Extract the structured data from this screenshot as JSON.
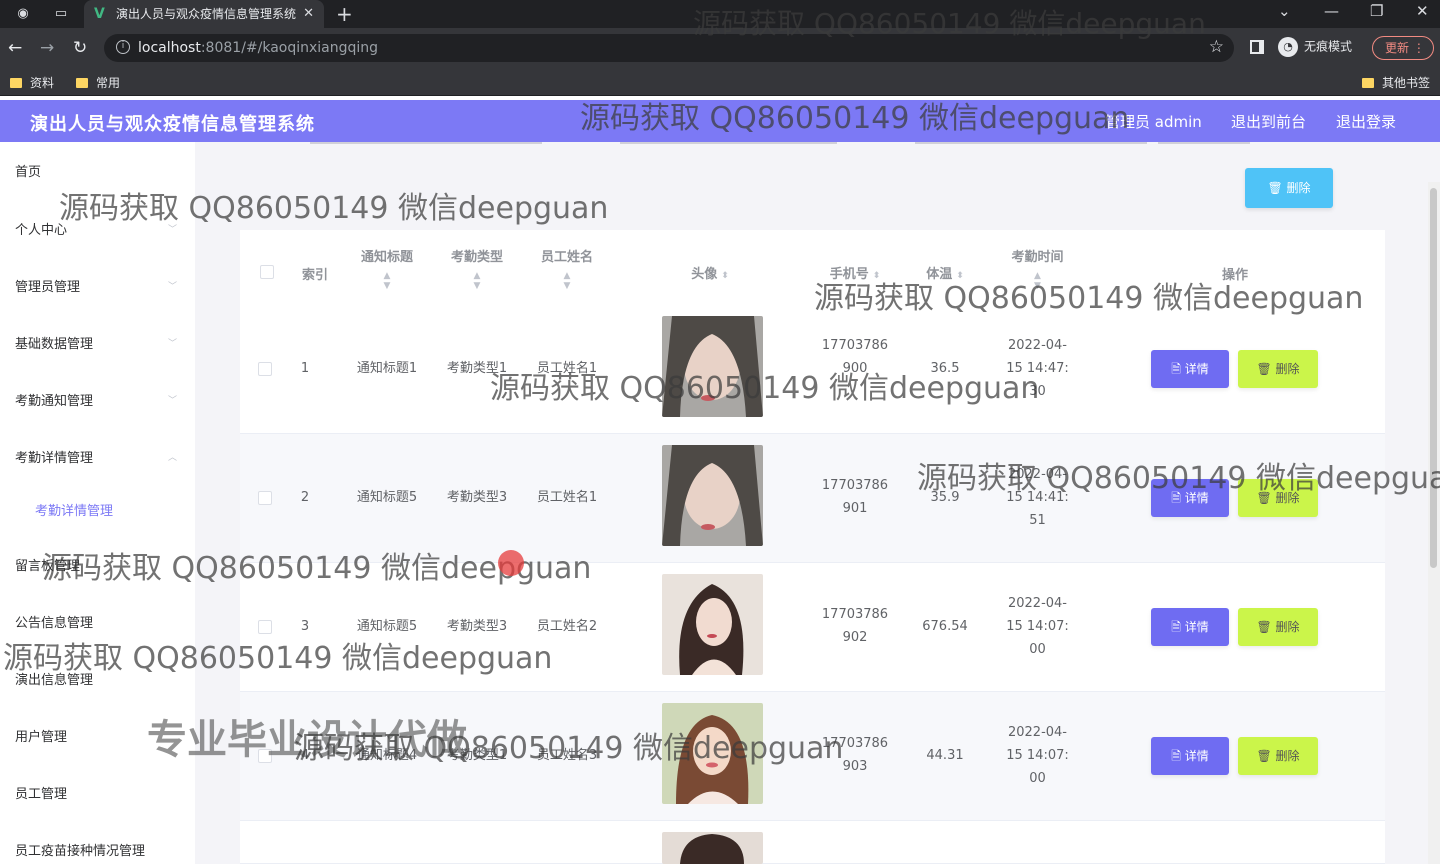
{
  "browser": {
    "tab_title": "演出人员与观众疫情信息管理系统",
    "url_host": "localhost",
    "url_rest": ":8081/#/kaoqinxiangqing",
    "incognito_label": "无痕模式",
    "update_label": "更新",
    "bookmarks": [
      "资料",
      "常用"
    ],
    "other_bookmarks": "其他书签"
  },
  "header": {
    "title": "演出人员与观众疫情信息管理系统",
    "admin_label": "管理员 admin",
    "back_label": "退出到前台",
    "logout_label": "退出登录"
  },
  "sidebar": {
    "items": [
      "首页",
      "个人中心",
      "管理员管理",
      "基础数据管理",
      "考勤通知管理",
      "考勤详情管理",
      "考勤详情管理",
      "留言板管理",
      "公告信息管理",
      "演出信息管理",
      "用户管理",
      "员工管理",
      "员工疫苗接种情况管理"
    ]
  },
  "toolbar": {
    "delete_label": "删除"
  },
  "table": {
    "headers": {
      "index": "索引",
      "title": "通知标题",
      "type": "考勤类型",
      "name": "员工姓名",
      "avatar": "头像",
      "phone": "手机号",
      "temp": "体温",
      "time": "考勤时间",
      "ops": "操作"
    },
    "detail_label": "详情",
    "delete_label": "删除",
    "rows": [
      {
        "index": "1",
        "title": "通知标题1",
        "type": "考勤类型1",
        "name": "员工姓名1",
        "phone1": "17703786",
        "phone2": "900",
        "temp": "36.5",
        "t1": "2022-04-",
        "t2": "15 14:47:",
        "t3": "30"
      },
      {
        "index": "2",
        "title": "通知标题5",
        "type": "考勤类型3",
        "name": "员工姓名1",
        "phone1": "17703786",
        "phone2": "901",
        "temp": "35.9",
        "t1": "2022-04-",
        "t2": "15 14:41:",
        "t3": "51"
      },
      {
        "index": "3",
        "title": "通知标题5",
        "type": "考勤类型3",
        "name": "员工姓名2",
        "phone1": "17703786",
        "phone2": "902",
        "temp": "676.54",
        "t1": "2022-04-",
        "t2": "15 14:07:",
        "t3": "00"
      },
      {
        "index": "4",
        "title": "通知标题4",
        "type": "考勤类型1",
        "name": "员工姓名3",
        "phone1": "17703786",
        "phone2": "903",
        "temp": "44.31",
        "t1": "2022-04-",
        "t2": "15 14:07:",
        "t3": "00"
      }
    ]
  },
  "watermarks": {
    "source": "源码获取 QQ86050149 微信deepguan",
    "source_cut": "源码获取 QQ86050149 微信deepguar",
    "pro": "专业毕业设计代做"
  },
  "colors": {
    "header": "#7c79f5",
    "detail_btn": "#6f6cf2",
    "delete_btn": "#cbf54a",
    "top_delete": "#4fc3f7"
  }
}
